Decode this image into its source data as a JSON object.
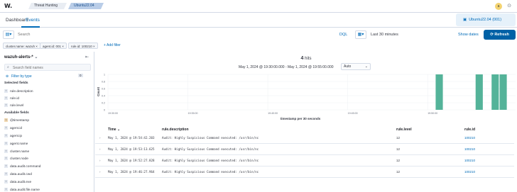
{
  "header": {
    "logo": "W.",
    "breadcrumb": [
      "Threat Hunting",
      "Ubuntu22.04"
    ],
    "avatar": "a",
    "help_icon": "help-icon"
  },
  "tabs": [
    {
      "label": "Dashboard"
    },
    {
      "label": "Events"
    }
  ],
  "agent": {
    "label": "Ubuntu22.04 (001)"
  },
  "search": {
    "placeholder": "Search",
    "language": "DQL",
    "date_range": "Last 30 minutes",
    "show_dates": "Show dates",
    "refresh": "Refresh"
  },
  "filters": [
    "cluster.name: wazuh",
    "agent.id: 001",
    "rule.id: 100210"
  ],
  "add_filter": "+ Add filter",
  "sidebar": {
    "index_pattern": "wazuh-alerts-*",
    "search_placeholder": "Search field names",
    "filter_by_type": "Filter by type",
    "filter_count": "0",
    "selected_title": "Selected fields",
    "selected_fields": [
      "rule.description",
      "rule.id",
      "rule.level"
    ],
    "available_title": "Available fields",
    "available_fields": [
      "@timestamp",
      "agent.id",
      "agent.ip",
      "agent.name",
      "cluster.name",
      "cluster.node",
      "data.audit.command",
      "data.audit.cwd",
      "data.audit.exe",
      "data.audit.file.name"
    ]
  },
  "results": {
    "hits": "4",
    "hits_label": "hits",
    "range": "May 1, 2024 @ 19:30:00.000 - May 1, 2024 @ 19:55:00.000",
    "interval": "Auto"
  },
  "chart_data": {
    "type": "bar",
    "ylabel": "Count",
    "xlabel": "timestamp per 30 seconds",
    "yticks": [
      "1",
      "0.8",
      "0.6",
      "0.4",
      "0.2",
      "0"
    ],
    "xticks": [
      "19:30:00",
      "19:35:00",
      "19:40:00",
      "19:45:00",
      "19:50:00"
    ],
    "ylim": [
      0,
      1
    ],
    "bar_color": "#54b399",
    "x": [
      "19:50:30",
      "19:53:00",
      "19:54:00",
      "19:54:30"
    ],
    "values": [
      1,
      1,
      1,
      1
    ]
  },
  "table": {
    "columns": [
      "Time",
      "rule.description",
      "rule.level",
      "rule.id"
    ],
    "rows": [
      {
        "time": "May 1, 2024 @ 19:54:42.203",
        "description": "Audit: Highly Suspicious Command executed: /usr/bin/nc",
        "level": "12",
        "id": "100210"
      },
      {
        "time": "May 1, 2024 @ 19:53:13.625",
        "description": "Audit: Highly Suspicious Command executed: /usr/bin/nc",
        "level": "12",
        "id": "100210"
      },
      {
        "time": "May 1, 2024 @ 19:52:27.828",
        "description": "Audit: Highly Suspicious Command executed: /usr/bin/nc",
        "level": "12",
        "id": "100210"
      },
      {
        "time": "May 1, 2024 @ 19:46:27.964",
        "description": "Audit: Highly Suspicious Command executed: /usr/bin/nc",
        "level": "12",
        "id": "100210"
      }
    ]
  }
}
